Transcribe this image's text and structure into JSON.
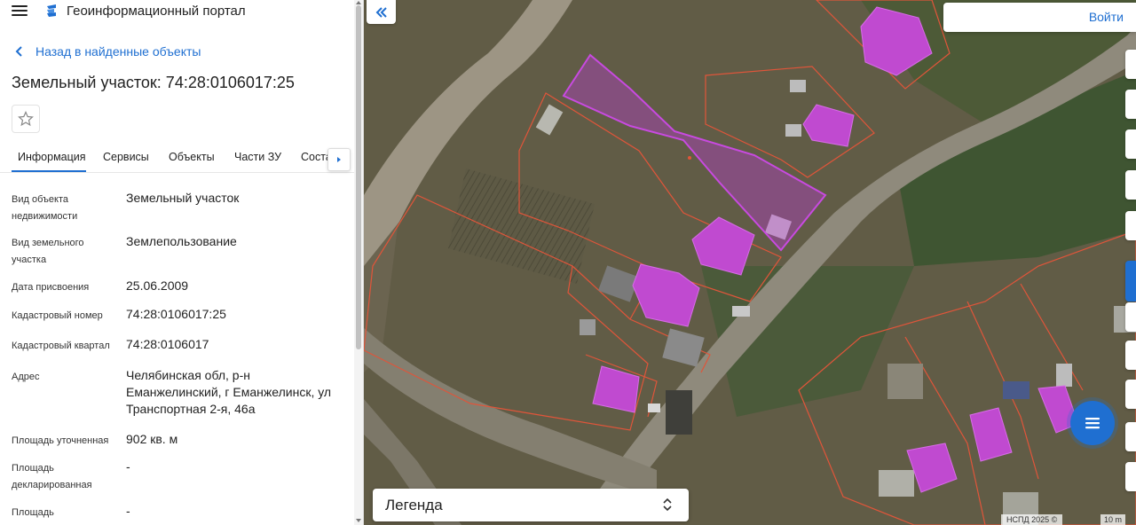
{
  "header": {
    "portal_title": "Геоинформационный портал"
  },
  "nav": {
    "back_label": "Назад в найденные объекты"
  },
  "object": {
    "title": "Земельный участок: 74:28:0106017:25"
  },
  "tabs": [
    {
      "label": "Информация",
      "active": true
    },
    {
      "label": "Сервисы"
    },
    {
      "label": "Объекты"
    },
    {
      "label": "Части ЗУ"
    },
    {
      "label": "Соста"
    }
  ],
  "properties": [
    {
      "label": "Вид объекта недвижимости",
      "value": "Земельный участок"
    },
    {
      "label": "Вид земельного участка",
      "value": "Землепользование"
    },
    {
      "label": "Дата присвоения",
      "value": "25.06.2009"
    },
    {
      "label": "Кадастровый номер",
      "value": "74:28:0106017:25"
    },
    {
      "label": "Кадастровый квартал",
      "value": "74:28:0106017"
    },
    {
      "label": "Адрес",
      "value": "Челябинская обл, р-н Еманжелинский, г Еманжелинск, ул Транспортная 2-я, 46а"
    },
    {
      "label": "Площадь уточненная",
      "value": "902 кв. м"
    },
    {
      "label": "Площадь декларированная",
      "value": "-"
    },
    {
      "label": "Площадь",
      "value": "-"
    }
  ],
  "map": {
    "login_label": "Войти",
    "legend_label": "Легенда",
    "attribution": "НСПД 2025 ©",
    "scale_label": "10 m"
  },
  "colors": {
    "accent": "#1f6fd1",
    "parcel_highlight": "#c040d0",
    "parcel_border": "#e0553a"
  }
}
